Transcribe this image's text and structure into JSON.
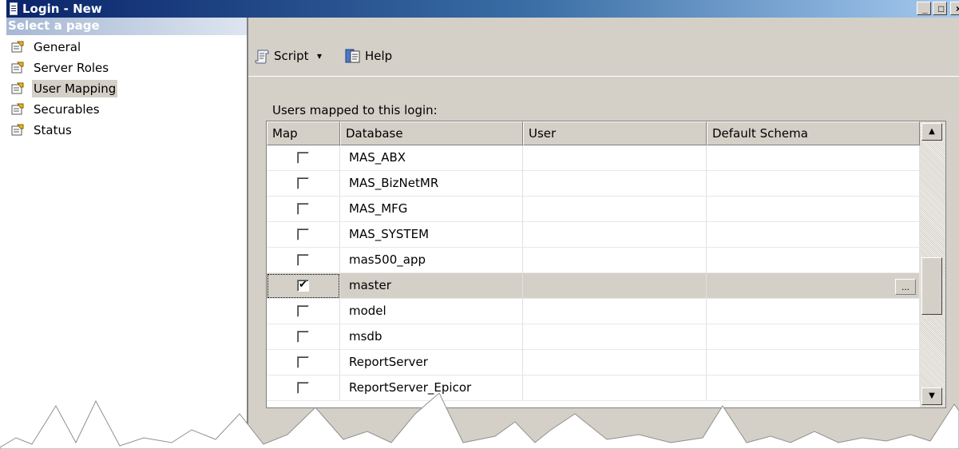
{
  "window": {
    "title": "Login - New",
    "controls": {
      "minimize": "_",
      "maximize": "□",
      "close": "×"
    }
  },
  "left_pane": {
    "header": "Select a page",
    "items": [
      {
        "label": "General",
        "icon": "page-icon",
        "active": false
      },
      {
        "label": "Server Roles",
        "icon": "page-icon",
        "active": false
      },
      {
        "label": "User Mapping",
        "icon": "page-icon",
        "active": true
      },
      {
        "label": "Securables",
        "icon": "page-icon",
        "active": false
      },
      {
        "label": "Status",
        "icon": "page-icon",
        "active": false
      }
    ]
  },
  "toolbar": {
    "script_label": "Script",
    "script_dropdown": "▾",
    "help_label": "Help"
  },
  "mapping": {
    "label": "Users mapped to this login:",
    "columns": [
      "Map",
      "Database",
      "User",
      "Default Schema"
    ],
    "rows": [
      {
        "checked": false,
        "database": "MAS_ABX",
        "user": "",
        "schema": ""
      },
      {
        "checked": false,
        "database": "MAS_BizNetMR",
        "user": "",
        "schema": ""
      },
      {
        "checked": false,
        "database": "MAS_MFG",
        "user": "",
        "schema": ""
      },
      {
        "checked": false,
        "database": "MAS_SYSTEM",
        "user": "",
        "schema": ""
      },
      {
        "checked": false,
        "database": "mas500_app",
        "user": "",
        "schema": ""
      },
      {
        "checked": true,
        "database": "master",
        "user": "",
        "schema": "",
        "selected": true,
        "browse_button": "..."
      },
      {
        "checked": false,
        "database": "model",
        "user": "",
        "schema": ""
      },
      {
        "checked": false,
        "database": "msdb",
        "user": "",
        "schema": ""
      },
      {
        "checked": false,
        "database": "ReportServer",
        "user": "",
        "schema": ""
      },
      {
        "checked": false,
        "database": "ReportServer_Epicor",
        "user": "",
        "schema": ""
      }
    ],
    "scroll_up": "▲",
    "scroll_down": "▼"
  },
  "colors": {
    "title_start": "#0a246a",
    "title_end": "#a6caf0",
    "face": "#d4d0c8"
  }
}
